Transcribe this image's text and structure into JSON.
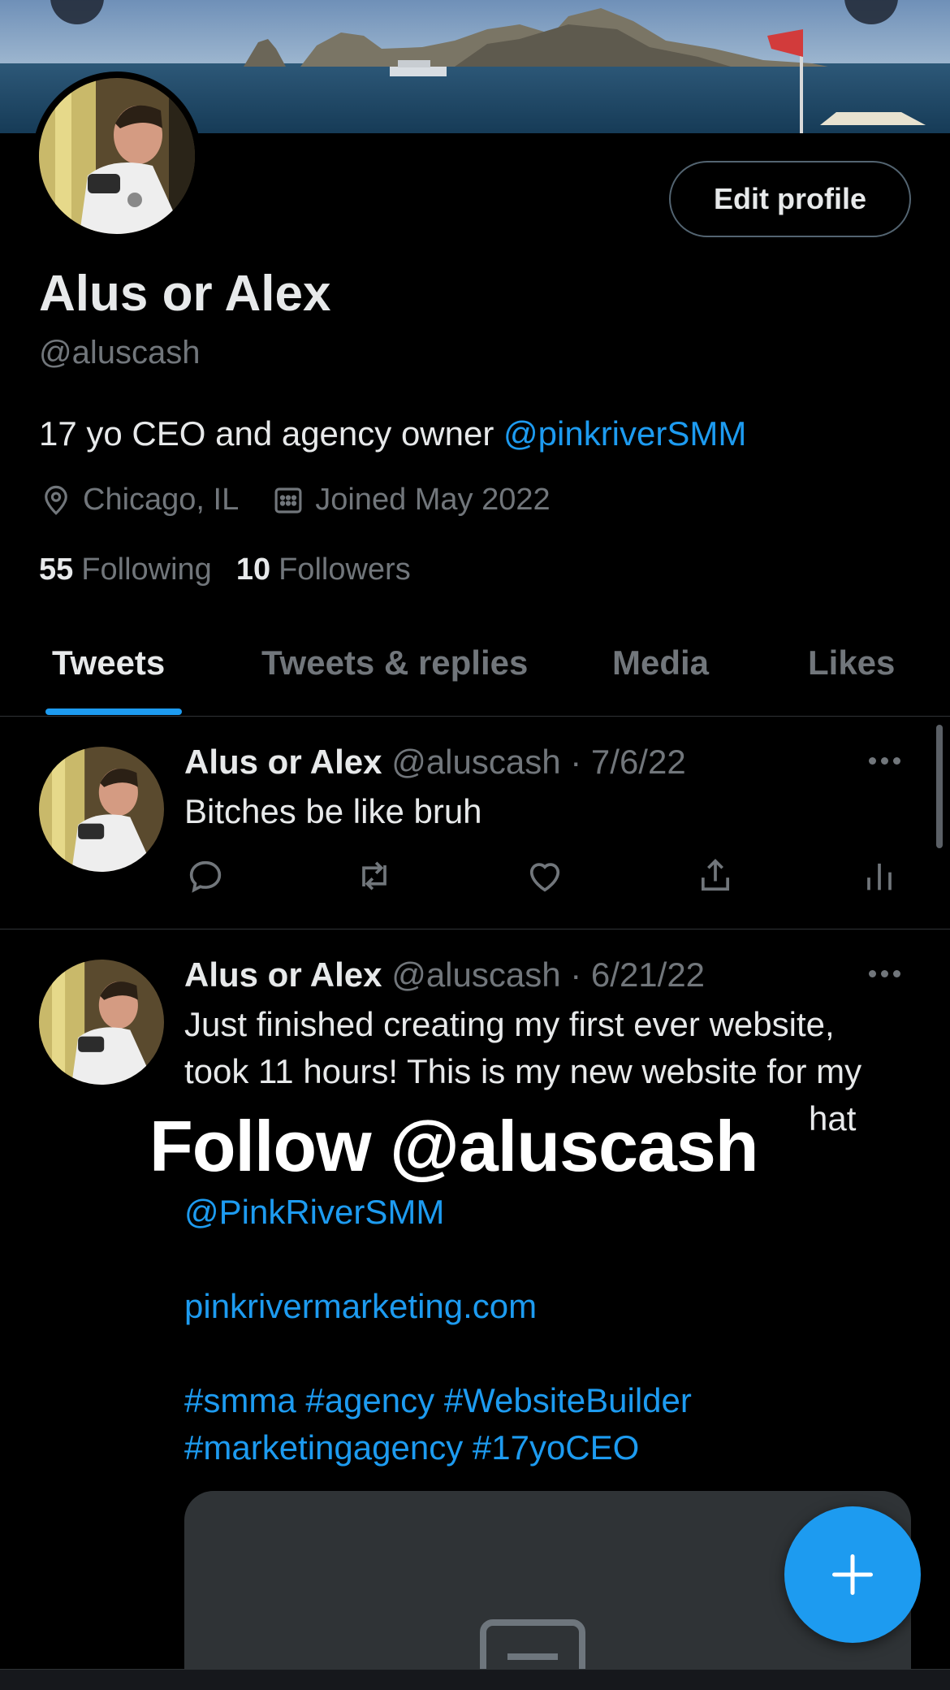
{
  "banner": {
    "back_icon": "arrow-left-icon",
    "search_icon": "search-icon"
  },
  "profile": {
    "display_name": "Alus or Alex",
    "handle": "@aluscash",
    "bio_text": "17 yo CEO and agency owner ",
    "bio_mention": "@pinkriverSMM",
    "location": "Chicago, IL",
    "joined": "Joined May 2022",
    "following_count": "55",
    "following_label": "Following",
    "followers_count": "10",
    "followers_label": "Followers",
    "edit_button": "Edit profile"
  },
  "tabs": [
    {
      "label": "Tweets",
      "active": true
    },
    {
      "label": "Tweets & replies",
      "active": false
    },
    {
      "label": "Media",
      "active": false
    },
    {
      "label": "Likes",
      "active": false
    }
  ],
  "tweets": [
    {
      "name": "Alus or Alex",
      "meta": "@aluscash · 7/6/22",
      "lines": [
        "Bitches be like bruh"
      ]
    },
    {
      "name": "Alus or Alex",
      "meta": "@aluscash · 6/21/22",
      "lines": [
        "Just finished creating my first ever website,",
        "took 11 hours! This is my new website for my",
        "hat"
      ],
      "mention": "@PinkRiverSMM",
      "url": "pinkrivermarketing.com",
      "hashtags_line1": "#smma #agency #WebsiteBuilder",
      "hashtags_line2": "#marketingagency #17yoCEO"
    }
  ],
  "overlay": "Follow @aluscash",
  "colors": {
    "accent": "#1d9bf0",
    "background": "#000000",
    "muted": "#71767b",
    "text": "#e7e9ea"
  },
  "icons": {
    "location": "location-pin-icon",
    "calendar": "calendar-icon",
    "reply": "reply-icon",
    "retweet": "retweet-icon",
    "like": "heart-icon",
    "share": "share-icon",
    "analytics": "analytics-icon",
    "compose": "plus-icon"
  }
}
